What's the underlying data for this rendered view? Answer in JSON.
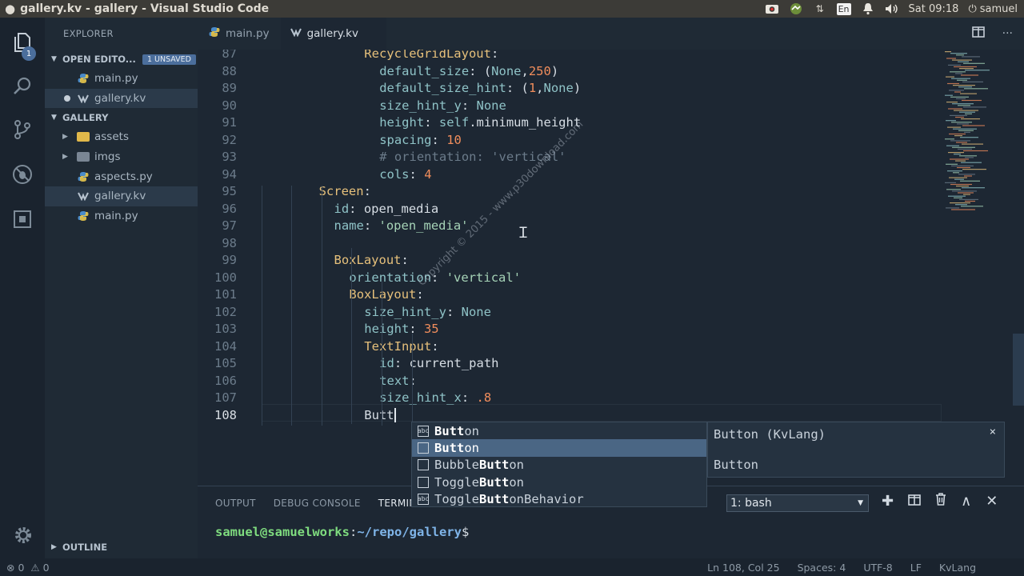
{
  "window": {
    "title": "gallery.kv - gallery - Visual Studio Code"
  },
  "tray": {
    "lang": "En",
    "clock": "Sat 09:18",
    "user": "samuel"
  },
  "activity": {
    "badge": "1"
  },
  "sidebar": {
    "header": "EXPLORER",
    "open_editors": {
      "label": "OPEN EDITO...",
      "unsaved": "1 UNSAVED",
      "items": [
        "main.py",
        "gallery.kv"
      ]
    },
    "folder": {
      "label": "GALLERY",
      "items": [
        "assets",
        "imgs",
        "aspects.py",
        "gallery.kv",
        "main.py"
      ]
    },
    "outline": "OUTLINE"
  },
  "tabs": [
    "main.py",
    "gallery.kv"
  ],
  "editor": {
    "line_numbers": [
      "87",
      "88",
      "89",
      "90",
      "91",
      "92",
      "93",
      "94",
      "95",
      "96",
      "97",
      "98",
      "99",
      "100",
      "101",
      "102",
      "103",
      "104",
      "105",
      "106",
      "107",
      "108"
    ],
    "lines": [
      {
        "t": [
          [
            "k",
            "RecycleGridLayout"
          ],
          [
            "v",
            ":"
          ]
        ]
      },
      {
        "t": [
          [
            "p",
            "default_size"
          ],
          [
            "v",
            ": ("
          ],
          [
            "p",
            "None"
          ],
          [
            "v",
            ","
          ],
          [
            "n",
            "250"
          ],
          [
            "v",
            ")"
          ]
        ]
      },
      {
        "t": [
          [
            "p",
            "default_size_hint"
          ],
          [
            "v",
            ": ("
          ],
          [
            "n",
            "1"
          ],
          [
            "v",
            ","
          ],
          [
            "p",
            "None"
          ],
          [
            "v",
            ")"
          ]
        ]
      },
      {
        "t": [
          [
            "p",
            "size_hint_y"
          ],
          [
            "v",
            ": "
          ],
          [
            "p",
            "None"
          ]
        ]
      },
      {
        "t": [
          [
            "p",
            "height"
          ],
          [
            "v",
            ": "
          ],
          [
            "p",
            "self"
          ],
          [
            "v",
            ".minimum_height"
          ]
        ]
      },
      {
        "t": [
          [
            "p",
            "spacing"
          ],
          [
            "v",
            ": "
          ],
          [
            "n",
            "10"
          ]
        ]
      },
      {
        "t": [
          [
            "c",
            "# orientation: 'vertical'"
          ]
        ]
      },
      {
        "t": [
          [
            "p",
            "cols"
          ],
          [
            "v",
            ": "
          ],
          [
            "n",
            "4"
          ]
        ]
      },
      {
        "t": [
          [
            "k",
            "Screen"
          ],
          [
            "v",
            ":"
          ]
        ]
      },
      {
        "t": [
          [
            "p",
            "id"
          ],
          [
            "v",
            ": open_media"
          ]
        ]
      },
      {
        "t": [
          [
            "p",
            "name"
          ],
          [
            "v",
            ": "
          ],
          [
            "s",
            "'open_media'"
          ]
        ]
      },
      {
        "t": []
      },
      {
        "t": [
          [
            "k",
            "BoxLayout"
          ],
          [
            "v",
            ":"
          ]
        ]
      },
      {
        "t": [
          [
            "p",
            "orientation"
          ],
          [
            "v",
            ": "
          ],
          [
            "s",
            "'vertical'"
          ]
        ]
      },
      {
        "t": [
          [
            "k",
            "BoxLayout"
          ],
          [
            "v",
            ":"
          ]
        ]
      },
      {
        "t": [
          [
            "p",
            "size_hint_y"
          ],
          [
            "v",
            ": "
          ],
          [
            "p",
            "None"
          ]
        ]
      },
      {
        "t": [
          [
            "p",
            "height"
          ],
          [
            "v",
            ": "
          ],
          [
            "n",
            "35"
          ]
        ]
      },
      {
        "t": [
          [
            "k",
            "TextInput"
          ],
          [
            "v",
            ":"
          ]
        ]
      },
      {
        "t": [
          [
            "p",
            "id"
          ],
          [
            "v",
            ": current_path"
          ]
        ]
      },
      {
        "t": [
          [
            "p",
            "text"
          ],
          [
            "v",
            ":"
          ]
        ]
      },
      {
        "t": [
          [
            "p",
            "size_hint_x"
          ],
          [
            "v",
            ": "
          ],
          [
            "n",
            ".8"
          ]
        ]
      },
      {
        "t": [
          [
            "v",
            "Butt"
          ]
        ]
      }
    ],
    "indents": [
      7,
      8,
      8,
      8,
      8,
      8,
      8,
      8,
      4,
      5,
      5,
      0,
      5,
      6,
      6,
      7,
      7,
      7,
      8,
      8,
      8,
      7
    ]
  },
  "suggest": {
    "items": [
      {
        "icon": "abc",
        "pre": "Butt",
        "rest": "on"
      },
      {
        "icon": "box",
        "pre": "Butt",
        "rest": "on"
      },
      {
        "icon": "box",
        "pre": "Bubble",
        "mid": "Butt",
        "rest": "on"
      },
      {
        "icon": "box",
        "pre": "Toggle",
        "mid": "Butt",
        "rest": "on"
      },
      {
        "icon": "abc",
        "pre": "Toggle",
        "mid": "Butt",
        "rest": "onBehavior"
      }
    ],
    "detail_title": "Button (KvLang)",
    "detail_body": "Button"
  },
  "panel": {
    "tabs": [
      "OUTPUT",
      "DEBUG CONSOLE",
      "TERMINA"
    ],
    "terminal_select": "1: bash",
    "prompt_user": "samuel@samuelworks",
    "prompt_path": "~/repo/gallery",
    "prompt_suffix": "$"
  },
  "status": {
    "errors": "0",
    "warnings": "0",
    "position": "Ln 108, Col 25",
    "spaces": "Spaces: 4",
    "encoding": "UTF-8",
    "eol": "LF",
    "language": "KvLang"
  },
  "watermark": "Copyright © 2015 - www.p30download.com",
  "colors": {
    "accent": "#4b6e9c",
    "keyword": "#e6c07b",
    "property": "#8fc3c7",
    "number": "#f08d5c",
    "string": "#a6d3b7"
  }
}
